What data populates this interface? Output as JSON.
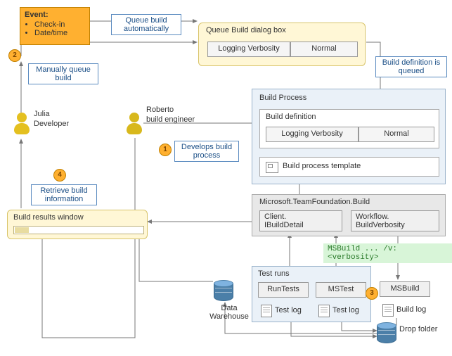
{
  "event": {
    "title": "Event:",
    "items": [
      "Check-in",
      "Date/time"
    ]
  },
  "labels": {
    "queue_auto": "Queue build\nautomatically",
    "manual_queue": "Manually queue\nbuild",
    "queued": "Build definition is\nqueued",
    "develops": "Develops build\nprocess",
    "retrieve": "Retrieve build\ninformation"
  },
  "steps": {
    "s1": "1",
    "s2": "2",
    "s3": "3",
    "s4": "4"
  },
  "people": {
    "julia_name": "Julia",
    "julia_role": "Developer",
    "roberto_name": "Roberto",
    "roberto_role": "build engineer"
  },
  "queue_dialog": {
    "title": "Queue Build dialog box",
    "field": "Logging Verbosity",
    "value": "Normal"
  },
  "build_process": {
    "title": "Build Process",
    "definition_title": "Build definition",
    "field": "Logging Verbosity",
    "value": "Normal",
    "template": "Build process template"
  },
  "tfbuild": {
    "title": "Microsoft.TeamFoundation.Build",
    "client_ns": "Client.",
    "client_if": "IBuildDetail",
    "wf_ns": "Workflow.",
    "wf_cls": "BuildVerbosity"
  },
  "msbuild_cmd": "MSBuild ... /v:<verbosity>",
  "test_runs": {
    "title": "Test runs",
    "runtests": "RunTests",
    "mstest": "MSTest",
    "msbuild": "MSBuild",
    "test_log": "Test log",
    "build_log": "Build log"
  },
  "results": {
    "title": "Build results window"
  },
  "data_warehouse": "Data\nWarehouse",
  "drop_folder": "Drop folder"
}
